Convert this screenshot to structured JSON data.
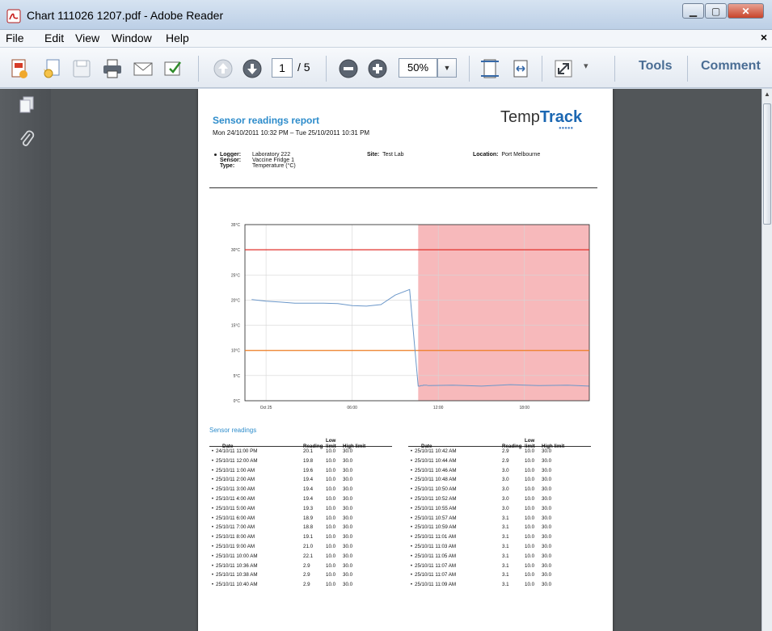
{
  "window": {
    "title": "Chart 111026 1207.pdf - Adobe Reader"
  },
  "menu": {
    "items": [
      "File",
      "Edit",
      "View",
      "Window",
      "Help"
    ],
    "close_glyph": "×"
  },
  "toolbar": {
    "page_current": "1",
    "page_total": "/ 5",
    "zoom": "50%",
    "tools_label": "Tools",
    "comment_label": "Comment"
  },
  "report": {
    "title": "Sensor readings report",
    "range": "Mon 24/10/2011 10:32 PM – Tue 25/10/2011 10:31 PM",
    "logo_plain": "Temp",
    "logo_bold": "Track",
    "logo_dots": "●●●●●",
    "logger_key": "Logger:",
    "logger_val": "Laboratory 222",
    "sensor_key": "Sensor:",
    "sensor_val": "Vaccine Fridge 1",
    "type_key": "Type:",
    "type_val": "Temperature (°C)",
    "site_key": "Site:",
    "site_val": "Test Lab",
    "location_key": "Location:",
    "location_val": "Port Melbourne",
    "readings_title": "Sensor readings",
    "columns": {
      "date": "Date",
      "reading": "Reading",
      "low": "Low limit",
      "high": "High limit"
    }
  },
  "colors": {
    "accent": "#2d8ccb",
    "high_limit": "#e0302b",
    "low_limit": "#ee7b21",
    "series": "#6b97c9",
    "alarm_zone": "#f7b9bb"
  },
  "chart_data": {
    "type": "line",
    "title": "",
    "xlabel": "",
    "ylabel": "",
    "y_ticks": [
      "0°C",
      "5°C",
      "10°C",
      "15°C",
      "20°C",
      "25°C",
      "30°C",
      "35°C"
    ],
    "x_ticks": [
      "Oct 25",
      "06:00",
      "12:00",
      "18:00"
    ],
    "ylim": [
      0,
      35
    ],
    "xlim_hours": [
      22.53,
      46.52
    ],
    "grid": true,
    "high_limit": 30,
    "low_limit": 10,
    "alarm_region_start_hour": 34.6,
    "series": [
      {
        "x_hours": [
          23,
          24,
          25,
          26,
          27,
          28,
          29,
          30,
          31,
          32,
          33,
          34,
          34.6,
          34.63,
          34.67,
          34.7,
          34.73,
          34.77,
          34.8,
          34.83,
          34.87,
          34.92,
          34.95,
          34.98,
          35.02,
          35.05,
          35.08,
          35.12,
          35.15,
          35.18,
          35.3,
          37,
          39,
          41,
          43,
          45,
          46.5
        ],
        "values": [
          20.1,
          19.8,
          19.6,
          19.4,
          19.4,
          19.4,
          19.3,
          18.9,
          18.8,
          19.1,
          21.0,
          22.1,
          2.9,
          2.9,
          2.9,
          2.9,
          2.9,
          3.0,
          3.0,
          3.0,
          3.0,
          3.0,
          3.1,
          3.1,
          3.1,
          3.1,
          3.1,
          3.1,
          3.1,
          3.1,
          3.0,
          3.1,
          2.9,
          3.2,
          3.0,
          3.1,
          2.9
        ]
      }
    ]
  },
  "readings_left": [
    {
      "date": "24/10/11 11:00 PM",
      "reading": "20.1",
      "low": "10.0",
      "high": "30.0"
    },
    {
      "date": "25/10/11 12:00 AM",
      "reading": "19.8",
      "low": "10.0",
      "high": "30.0"
    },
    {
      "date": "25/10/11 1:00 AM",
      "reading": "19.6",
      "low": "10.0",
      "high": "30.0"
    },
    {
      "date": "25/10/11 2:00 AM",
      "reading": "19.4",
      "low": "10.0",
      "high": "30.0"
    },
    {
      "date": "25/10/11 3:00 AM",
      "reading": "19.4",
      "low": "10.0",
      "high": "30.0"
    },
    {
      "date": "25/10/11 4:00 AM",
      "reading": "19.4",
      "low": "10.0",
      "high": "30.0"
    },
    {
      "date": "25/10/11 5:00 AM",
      "reading": "19.3",
      "low": "10.0",
      "high": "30.0"
    },
    {
      "date": "25/10/11 6:00 AM",
      "reading": "18.9",
      "low": "10.0",
      "high": "30.0"
    },
    {
      "date": "25/10/11 7:00 AM",
      "reading": "18.8",
      "low": "10.0",
      "high": "30.0"
    },
    {
      "date": "25/10/11 8:00 AM",
      "reading": "19.1",
      "low": "10.0",
      "high": "30.0"
    },
    {
      "date": "25/10/11 9:00 AM",
      "reading": "21.0",
      "low": "10.0",
      "high": "30.0"
    },
    {
      "date": "25/10/11 10:00 AM",
      "reading": "22.1",
      "low": "10.0",
      "high": "30.0"
    },
    {
      "date": "25/10/11 10:36 AM",
      "reading": "2.9",
      "low": "10.0",
      "high": "30.0"
    },
    {
      "date": "25/10/11 10:38 AM",
      "reading": "2.9",
      "low": "10.0",
      "high": "30.0"
    },
    {
      "date": "25/10/11 10:40 AM",
      "reading": "2.9",
      "low": "10.0",
      "high": "30.0"
    }
  ],
  "readings_right": [
    {
      "date": "25/10/11 10:42 AM",
      "reading": "2.9",
      "low": "10.0",
      "high": "30.0"
    },
    {
      "date": "25/10/11 10:44 AM",
      "reading": "2.9",
      "low": "10.0",
      "high": "30.0"
    },
    {
      "date": "25/10/11 10:46 AM",
      "reading": "3.0",
      "low": "10.0",
      "high": "30.0"
    },
    {
      "date": "25/10/11 10:48 AM",
      "reading": "3.0",
      "low": "10.0",
      "high": "30.0"
    },
    {
      "date": "25/10/11 10:50 AM",
      "reading": "3.0",
      "low": "10.0",
      "high": "30.0"
    },
    {
      "date": "25/10/11 10:52 AM",
      "reading": "3.0",
      "low": "10.0",
      "high": "30.0"
    },
    {
      "date": "25/10/11 10:55 AM",
      "reading": "3.0",
      "low": "10.0",
      "high": "30.0"
    },
    {
      "date": "25/10/11 10:57 AM",
      "reading": "3.1",
      "low": "10.0",
      "high": "30.0"
    },
    {
      "date": "25/10/11 10:59 AM",
      "reading": "3.1",
      "low": "10.0",
      "high": "30.0"
    },
    {
      "date": "25/10/11 11:01 AM",
      "reading": "3.1",
      "low": "10.0",
      "high": "30.0"
    },
    {
      "date": "25/10/11 11:03 AM",
      "reading": "3.1",
      "low": "10.0",
      "high": "30.0"
    },
    {
      "date": "25/10/11 11:05 AM",
      "reading": "3.1",
      "low": "10.0",
      "high": "30.0"
    },
    {
      "date": "25/10/11 11:07 AM",
      "reading": "3.1",
      "low": "10.0",
      "high": "30.0"
    },
    {
      "date": "25/10/11 11:07 AM",
      "reading": "3.1",
      "low": "10.0",
      "high": "30.0"
    },
    {
      "date": "25/10/11 11:09 AM",
      "reading": "3.1",
      "low": "10.0",
      "high": "30.0"
    }
  ]
}
